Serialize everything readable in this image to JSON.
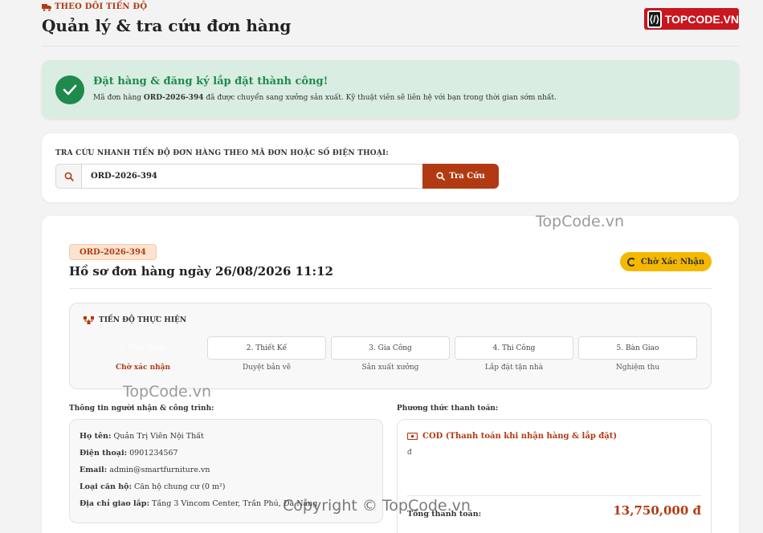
{
  "header": {
    "eyebrow": "THEO DÕI TIẾN ĐỘ",
    "title": "Quản lý & tra cứu đơn hàng",
    "logo_text": "TOPCODE.VN"
  },
  "alert": {
    "title": "Đặt hàng & đăng ký lắp đặt thành công!",
    "msg_prefix": "Mã đơn hàng",
    "order_code": "ORD-2026-394",
    "msg_suffix": "đã được chuyển sang xưởng sản xuất. Kỹ thuật viên sẽ liên hệ với bạn trong thời gian sớm nhất."
  },
  "search": {
    "label": "TRA CỨU NHANH TIẾN ĐỘ ĐƠN HÀNG THEO MÃ ĐƠN HOẶC SỐ ĐIỆN THOẠI:",
    "value": "ORD-2026-394",
    "button": "Tra Cứu"
  },
  "order": {
    "code": "ORD-2026-394",
    "title": "Hồ sơ đơn hàng ngày 26/08/2026 11:12",
    "status": "Chờ Xác Nhận",
    "progress_title": "TIẾN ĐỘ THỰC HIỆN",
    "steps": [
      {
        "label": "1. Tiếp Nhận",
        "sub": "Chờ xác nhận"
      },
      {
        "label": "2. Thiết Kế",
        "sub": "Duyệt bản vẽ"
      },
      {
        "label": "3. Gia Công",
        "sub": "Sản xuất xưởng"
      },
      {
        "label": "4. Thi Công",
        "sub": "Lắp đặt tận nhà"
      },
      {
        "label": "5. Bàn Giao",
        "sub": "Nghiệm thu"
      }
    ]
  },
  "customer": {
    "section": "Thông tin người nhận & công trình:",
    "name_label": "Họ tên:",
    "name": "Quản Trị Viên Nội Thất",
    "phone_label": "Điện thoại:",
    "phone": "0901234567",
    "email_label": "Email:",
    "email": "admin@smartfurniture.vn",
    "type_label": "Loại căn hộ:",
    "type": "Căn hộ chung cư (0 m²)",
    "address_label": "Địa chỉ giao lắp:",
    "address": "Tầng 3 Vincom Center, Trần Phú, Đà Nẵng"
  },
  "payment": {
    "section": "Phương thức thanh toán:",
    "method": "COD (Thanh toán khi nhận hàng & lắp đặt)",
    "note": "đ",
    "total_label": "Tổng thanh toán:",
    "total": "13,750,000 đ"
  },
  "watermarks": {
    "w1": "TopCode.vn",
    "w2": "TopCode.vn",
    "w3": "Copyright © TopCode.vn"
  },
  "colors": {
    "brand": "#b23a12",
    "success": "#1f8a4c",
    "success_bg": "#d9ede2",
    "status": "#f5b800"
  }
}
